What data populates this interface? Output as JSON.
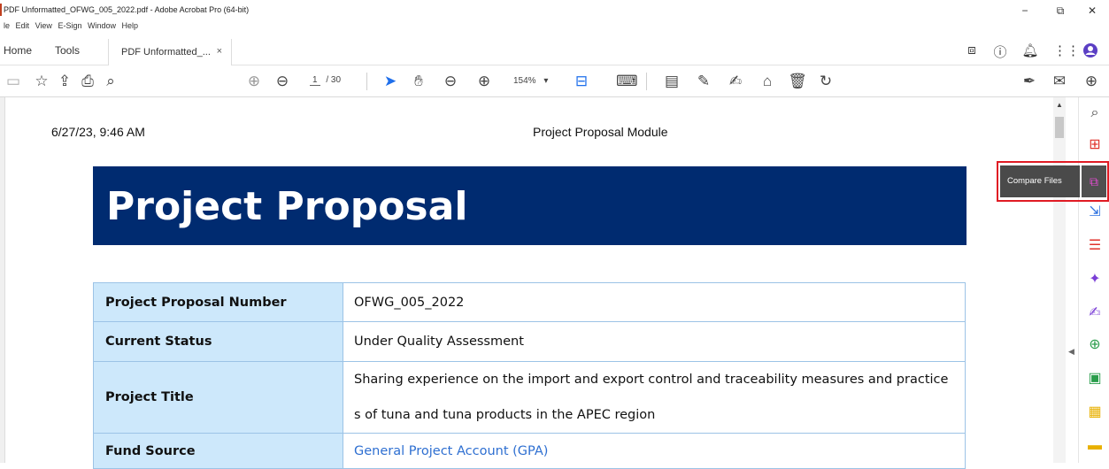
{
  "window": {
    "title": "PDF Unformatted_OFWG_005_2022.pdf - Adobe Acrobat Pro (64-bit)",
    "minimize": "−",
    "restore": "⧉",
    "close": "✕"
  },
  "menu": [
    "le",
    "Edit",
    "View",
    "E-Sign",
    "Window",
    "Help"
  ],
  "tabs": {
    "home": "Home",
    "tools": "Tools",
    "doc": "PDF Unformatted_...",
    "close": "×"
  },
  "toolbar": {
    "page_current": "1",
    "page_total": "/ 30",
    "zoom": "154%",
    "zoom_caret": "▾"
  },
  "doc": {
    "date": "6/27/23, 9:46 AM",
    "module": "Project Proposal Module",
    "banner_title": "Project Proposal",
    "rows": [
      {
        "key": "Project Proposal Number",
        "value": "OFWG_005_2022"
      },
      {
        "key": "Current Status",
        "value": "Under Quality Assessment"
      },
      {
        "key": "Project Title",
        "value": "Sharing experience on the import and export control and traceability measures and practice",
        "value2": "s of tuna and tuna products in the APEC region"
      },
      {
        "key": "Fund Source",
        "value": "General Project Account (GPA)"
      }
    ]
  },
  "tooltip": {
    "label": "Compare Files"
  },
  "colors": {
    "banner": "#002b70",
    "key_cell": "#cde8fb",
    "border": "#9cc3e6",
    "link": "#2e6fd1",
    "highlight": "#e01b24"
  }
}
